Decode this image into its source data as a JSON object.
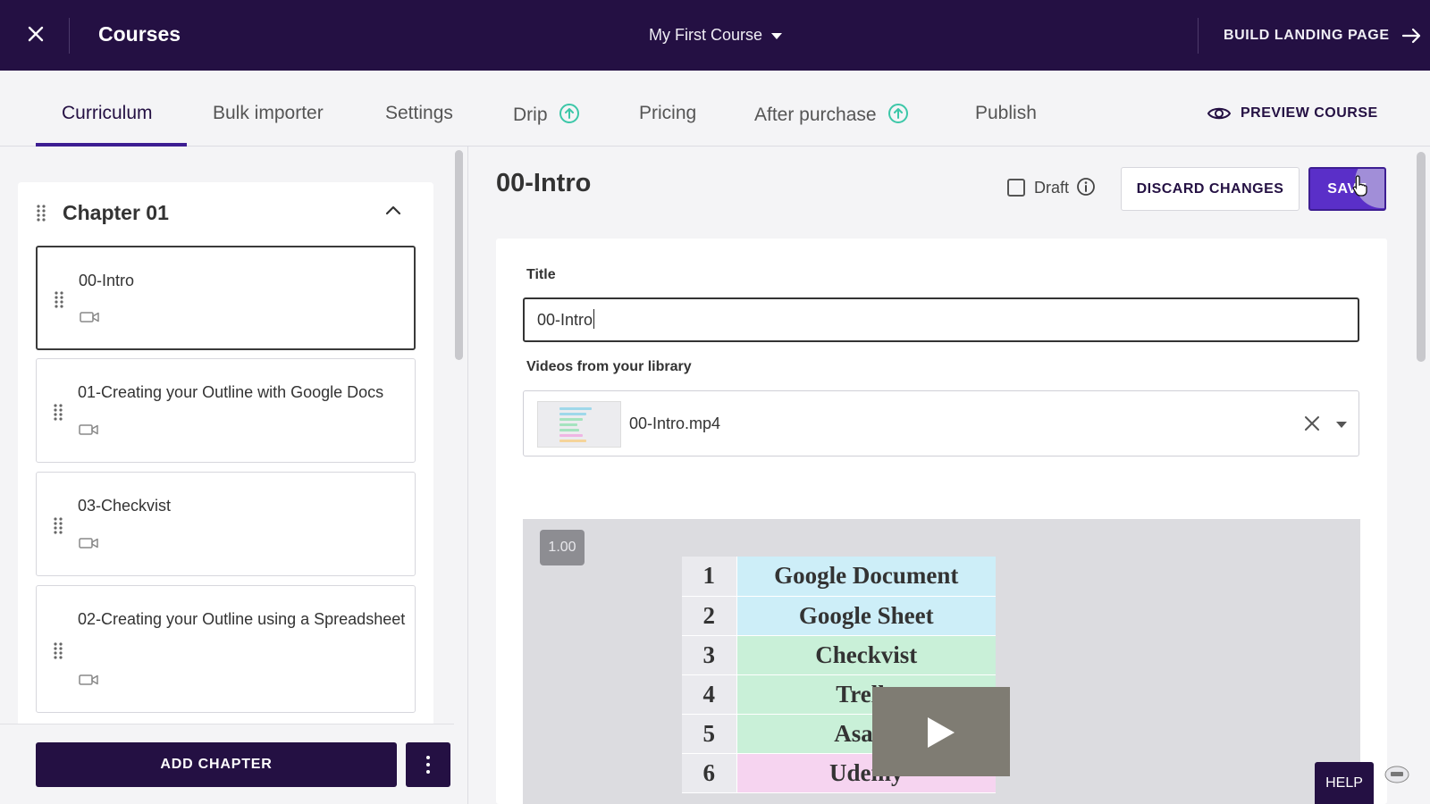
{
  "topbar": {
    "title": "Courses",
    "course_name": "My First Course",
    "build_landing_label": "BUILD LANDING PAGE"
  },
  "tabs": [
    {
      "label": "Curriculum",
      "active": true
    },
    {
      "label": "Bulk importer"
    },
    {
      "label": "Settings"
    },
    {
      "label": "Drip",
      "icon": "upgrade-icon"
    },
    {
      "label": "Pricing"
    },
    {
      "label": "After purchase",
      "icon": "upgrade-icon"
    },
    {
      "label": "Publish"
    }
  ],
  "preview_label": "PREVIEW COURSE",
  "chapter": {
    "title": "Chapter 01",
    "lessons": [
      {
        "title": "00-Intro",
        "selected": true
      },
      {
        "title": "01-Creating your Outline with Google Docs"
      },
      {
        "title": "03-Checkvist"
      },
      {
        "title": "02-Creating your Outline using a Spreadsheet"
      }
    ]
  },
  "add_chapter_label": "ADD CHAPTER",
  "editor": {
    "heading": "00-Intro",
    "draft_label": "Draft",
    "discard_label": "DISCARD CHANGES",
    "save_label": "SAVE",
    "title_label": "Title",
    "title_value": "00-Intro",
    "videos_label": "Videos from your library",
    "video_file": "00-Intro.mp4"
  },
  "player": {
    "speed": "1.00",
    "rows": [
      {
        "num": "1",
        "name": "Google Document",
        "color": "#cdeef8"
      },
      {
        "num": "2",
        "name": "Google Sheet",
        "color": "#cdeef8"
      },
      {
        "num": "3",
        "name": "Checkvist",
        "color": "#c9f0d8"
      },
      {
        "num": "4",
        "name": "Trello",
        "color": "#c9f0d8"
      },
      {
        "num": "5",
        "name": "Asana",
        "color": "#c9f0d8"
      },
      {
        "num": "6",
        "name": "Udemy",
        "color": "#f6d4f0"
      }
    ]
  },
  "help_label": "HELP",
  "colors": {
    "topbar": "#241043",
    "accent": "#3d1d92",
    "save": "#5a2fc8",
    "upgrade": "#3cc7a8"
  }
}
